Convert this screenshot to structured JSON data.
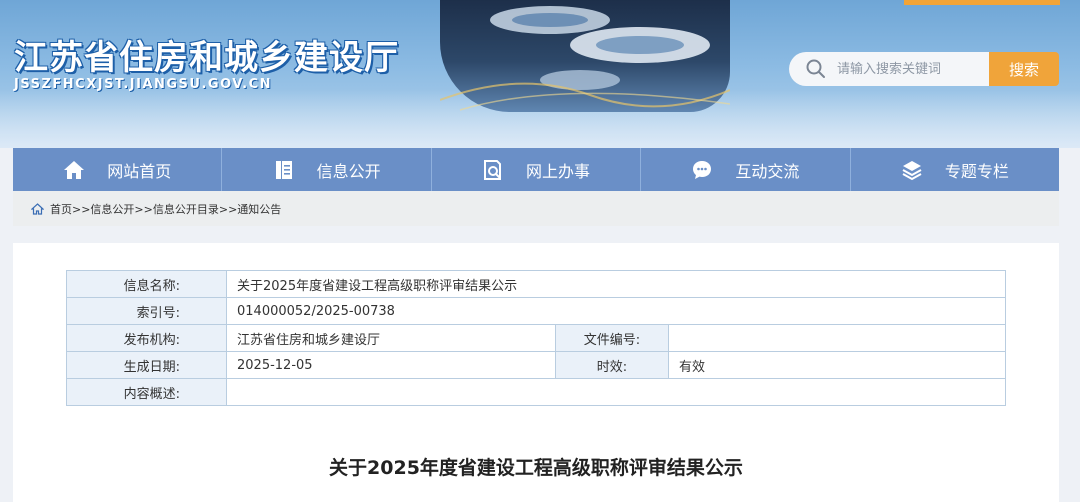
{
  "header": {
    "site_title": "江苏省住房和城乡建设厅",
    "site_domain": "JSSZFHCXJST.JIANGSU.GOV.CN",
    "search_placeholder": "请输入搜索关键词",
    "search_button": "搜索"
  },
  "nav": {
    "items": [
      {
        "label": "网站首页",
        "icon": "home-icon"
      },
      {
        "label": "信息公开",
        "icon": "document-icon"
      },
      {
        "label": "网上办事",
        "icon": "search-doc-icon"
      },
      {
        "label": "互动交流",
        "icon": "chat-icon"
      },
      {
        "label": "专题专栏",
        "icon": "layers-icon"
      }
    ]
  },
  "breadcrumb": {
    "text": "首页>>信息公开>>信息公开目录>>通知公告"
  },
  "info": {
    "name_label": "信息名称:",
    "name_value": "关于2025年度省建设工程高级职称评审结果公示",
    "index_label": "索引号:",
    "index_value": "014000052/2025-00738",
    "org_label": "发布机构:",
    "org_value": "江苏省住房和城乡建设厅",
    "docno_label": "文件编号:",
    "docno_value": "",
    "date_label": "生成日期:",
    "date_value": "2025-12-05",
    "validity_label": "时效:",
    "validity_value": "有效",
    "summary_label": "内容概述:",
    "summary_value": ""
  },
  "document": {
    "title": "关于2025年度省建设工程高级职称评审结果公示"
  },
  "colors": {
    "nav_bg": "#6a8fc7",
    "search_button": "#f0a43a",
    "label_bg": "#eaf1f9"
  }
}
